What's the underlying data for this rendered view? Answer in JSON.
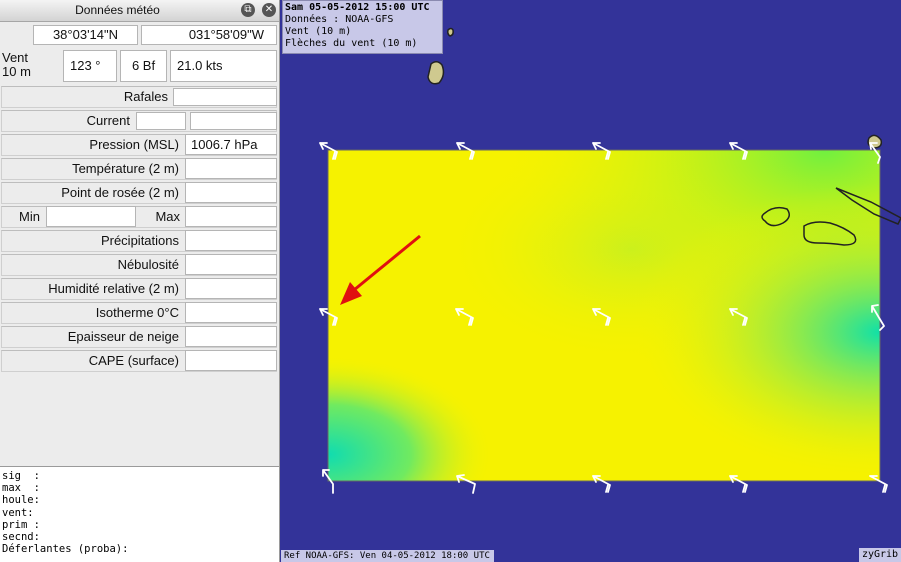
{
  "window": {
    "title": "Données météo"
  },
  "coords": {
    "lat": "38°03'14\"N",
    "lon": "031°58'09\"W"
  },
  "wind": {
    "label": "Vent\n10 m",
    "label_line1": "Vent",
    "label_line2": "10 m",
    "direction": "123 °",
    "beaufort": "6 Bf",
    "speed": "21.0  kts"
  },
  "fields": {
    "rafales": {
      "label": "Rafales",
      "value": ""
    },
    "current": {
      "label": "Current",
      "value": ""
    },
    "pression": {
      "label": "Pression (MSL)",
      "value": "1006.7 hPa"
    },
    "temperature": {
      "label": "Température (2 m)",
      "value": ""
    },
    "rosee": {
      "label": "Point de rosée (2 m)",
      "value": ""
    },
    "min": {
      "label": "Min",
      "value": ""
    },
    "max": {
      "label": "Max",
      "value": ""
    },
    "precip": {
      "label": "Précipitations",
      "value": ""
    },
    "nebulosite": {
      "label": "Nébulosité",
      "value": ""
    },
    "humidite": {
      "label": "Humidité relative (2 m)",
      "value": ""
    },
    "isotherme": {
      "label": "Isotherme 0°C",
      "value": ""
    },
    "neige": {
      "label": "Epaisseur de neige",
      "value": ""
    },
    "cape": {
      "label": "CAPE (surface)",
      "value": ""
    }
  },
  "console": [
    "sig  :",
    "max  :",
    "houle:",
    "vent:",
    "prim :",
    "secnd:",
    "Déferlantes (proba):"
  ],
  "map": {
    "info": {
      "date": "Sam 05-05-2012 15:00 UTC",
      "source": "Données : NOAA-GFS",
      "layer": "Vent (10 m)",
      "arrows": "Flèches du vent (10 m)"
    },
    "ref": "Ref NOAA-GFS: Ven 04-05-2012 18:00 UTC",
    "brand": "zyGrib",
    "colors": {
      "sea": "#333399",
      "field_yellow": "#f6f200",
      "field_green": "#1ee6a0",
      "land": "#cfc98f",
      "annotation": "#e01010"
    }
  }
}
